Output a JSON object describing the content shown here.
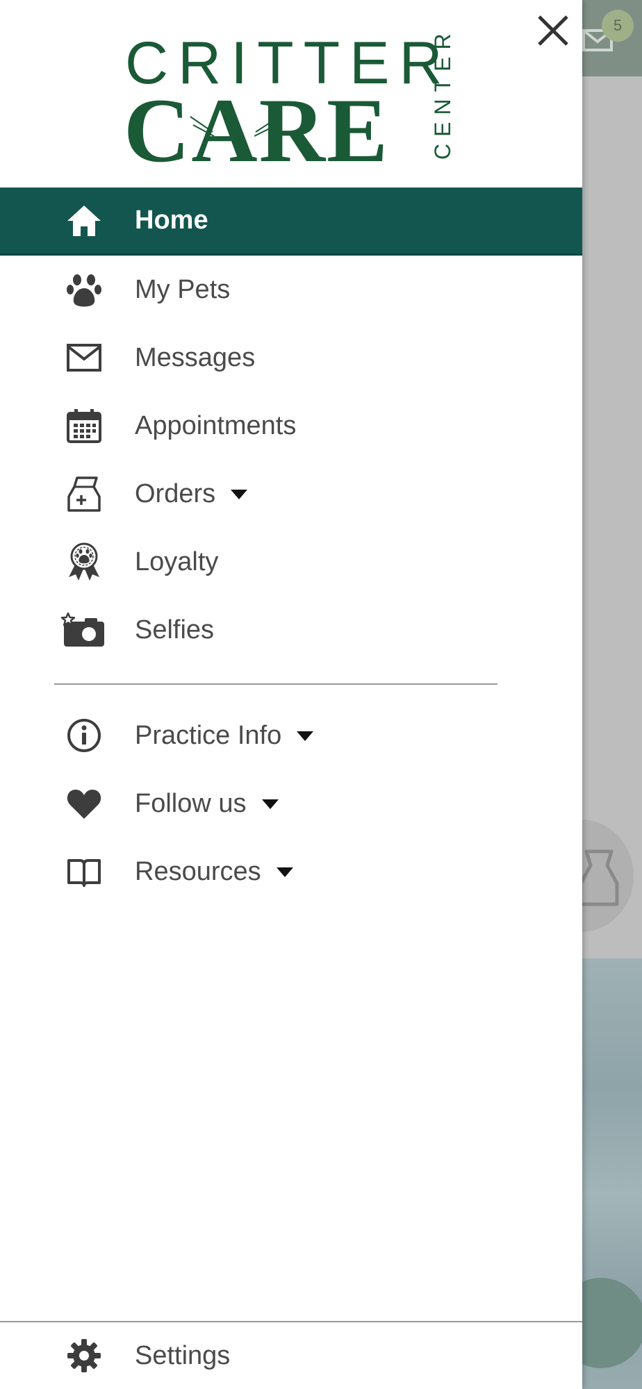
{
  "drawer": {
    "logo": {
      "line1": "CRITTER",
      "line2": "CARE",
      "side": "CENTER",
      "color": "#1a5a36"
    },
    "close_icon": "close-icon",
    "active_color": "#12564f",
    "menu": [
      {
        "label": "Home",
        "icon": "home-icon",
        "active": true
      },
      {
        "label": "My Pets",
        "icon": "paw-icon"
      },
      {
        "label": "Messages",
        "icon": "envelope-icon"
      },
      {
        "label": "Appointments",
        "icon": "calendar-icon"
      },
      {
        "label": "Orders",
        "icon": "food-bag-icon",
        "has_dropdown": true
      },
      {
        "label": "Loyalty",
        "icon": "award-ribbon-icon"
      },
      {
        "label": "Selfies",
        "icon": "camera-icon"
      }
    ],
    "secondary_menu": [
      {
        "label": "Practice Info",
        "icon": "info-icon",
        "has_dropdown": true
      },
      {
        "label": "Follow us",
        "icon": "heart-icon",
        "has_dropdown": true
      },
      {
        "label": "Resources",
        "icon": "book-icon",
        "has_dropdown": true
      }
    ],
    "settings": {
      "label": "Settings",
      "icon": "gear-icon"
    }
  },
  "background": {
    "mail_badge_count": "5"
  }
}
